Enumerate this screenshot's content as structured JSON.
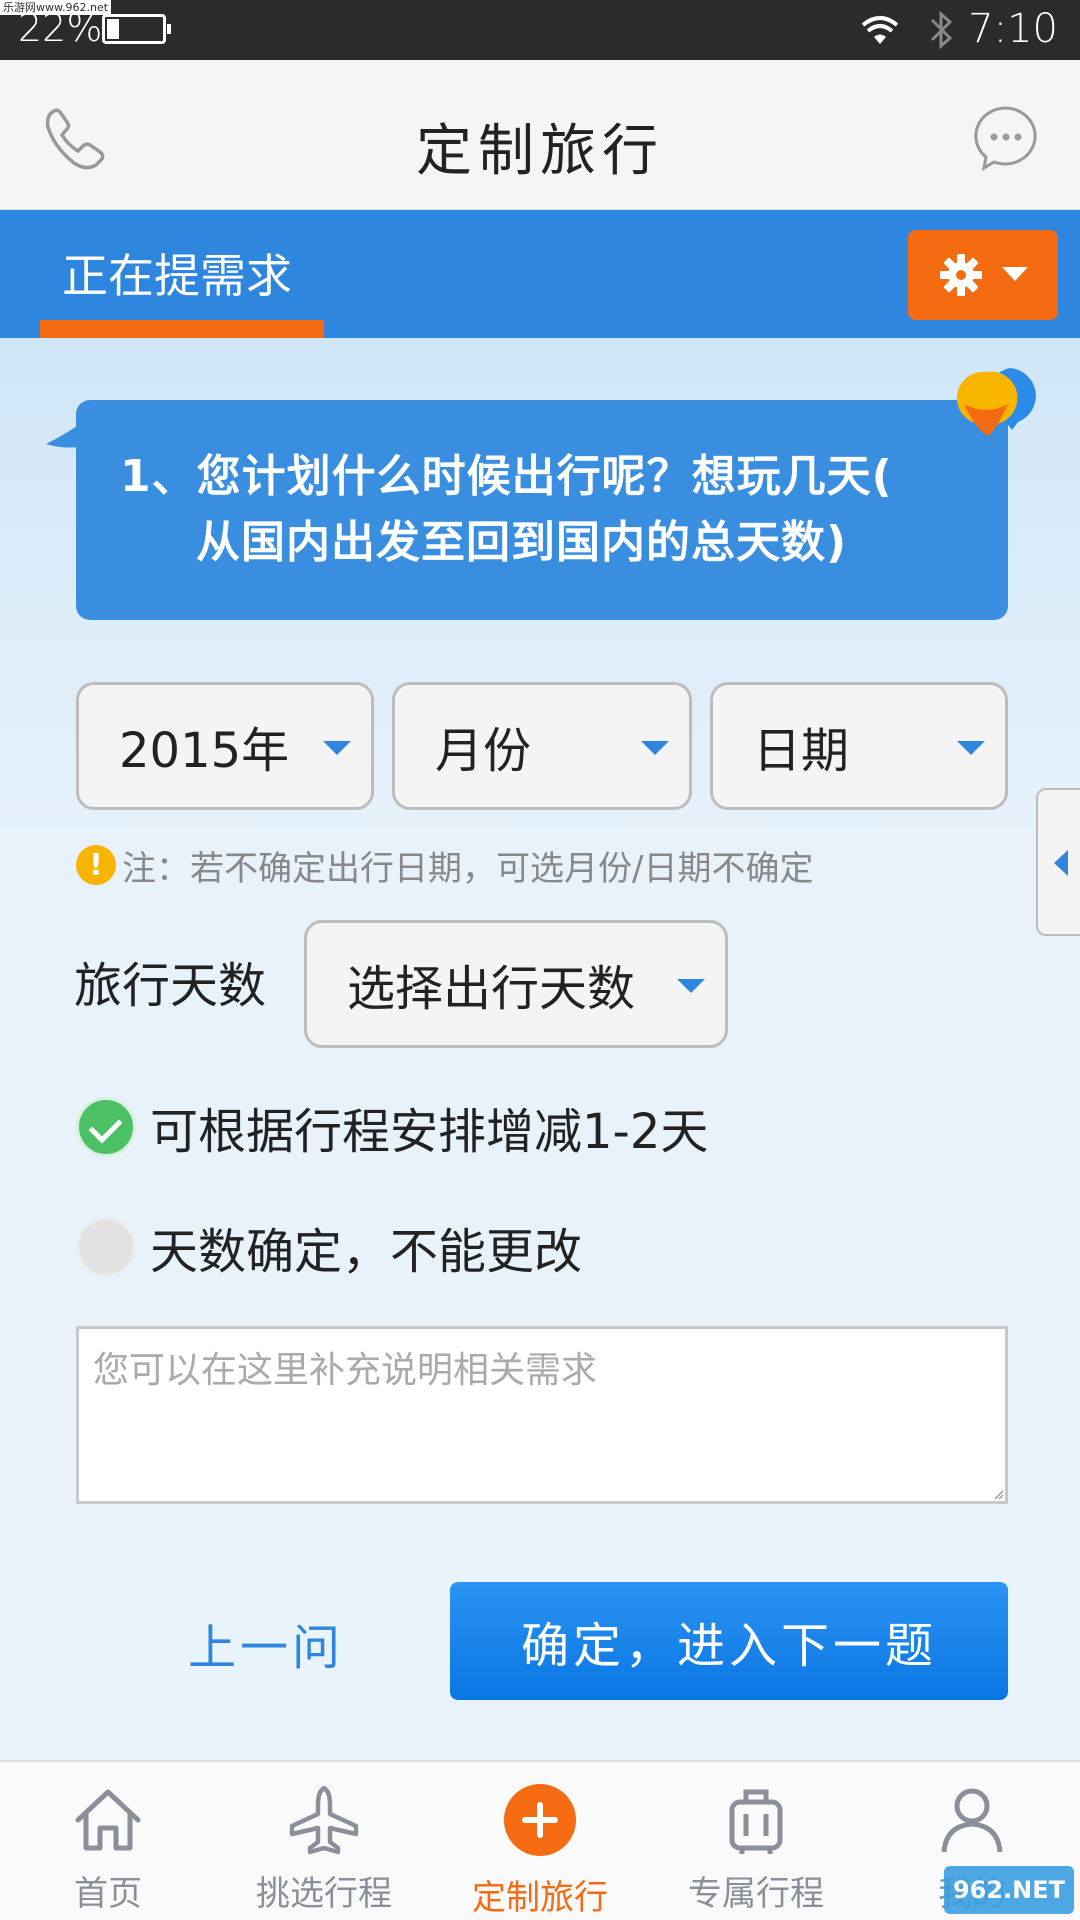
{
  "status_bar": {
    "watermark": "乐游网www.962.net",
    "battery_percent": "22%",
    "battery_level": 0.22,
    "time": "7:10",
    "icons": [
      "wifi-icon",
      "bluetooth-icon"
    ]
  },
  "header": {
    "title": "定制旅行",
    "left_icon": "phone-icon",
    "right_icon": "chat-icon"
  },
  "tab": {
    "label": "正在提需求",
    "settings_icon": "gear-icon"
  },
  "question": {
    "line1": "1、您计划什么时候出行呢？想玩几天(",
    "line2": "从国内出发至回到国内的总天数)"
  },
  "date_selects": {
    "year": "2015年",
    "month": "月份",
    "day": "日期"
  },
  "note": {
    "text": "注：若不确定出行日期，可选月份/日期不确定"
  },
  "days": {
    "label": "旅行天数",
    "select_value": "选择出行天数"
  },
  "options": [
    {
      "label": "可根据行程安排增减1-2天",
      "checked": true
    },
    {
      "label": "天数确定，不能更改",
      "checked": false
    }
  ],
  "textarea": {
    "placeholder": "您可以在这里补充说明相关需求"
  },
  "actions": {
    "prev": "上一问",
    "next": "确定，进入下一题"
  },
  "bottom_nav": [
    {
      "label": "首页",
      "icon": "home-icon",
      "active": false
    },
    {
      "label": "挑选行程",
      "icon": "plane-icon",
      "active": false
    },
    {
      "label": "定制旅行",
      "icon": "plus-icon",
      "active": true
    },
    {
      "label": "专属行程",
      "icon": "suitcase-icon",
      "active": false
    },
    {
      "label": "我的",
      "icon": "user-icon",
      "active": false
    }
  ],
  "watermark_bottom": "962.NET",
  "colors": {
    "primary_blue": "#2f86de",
    "accent_orange": "#f46b12",
    "check_green": "#4cc064"
  }
}
